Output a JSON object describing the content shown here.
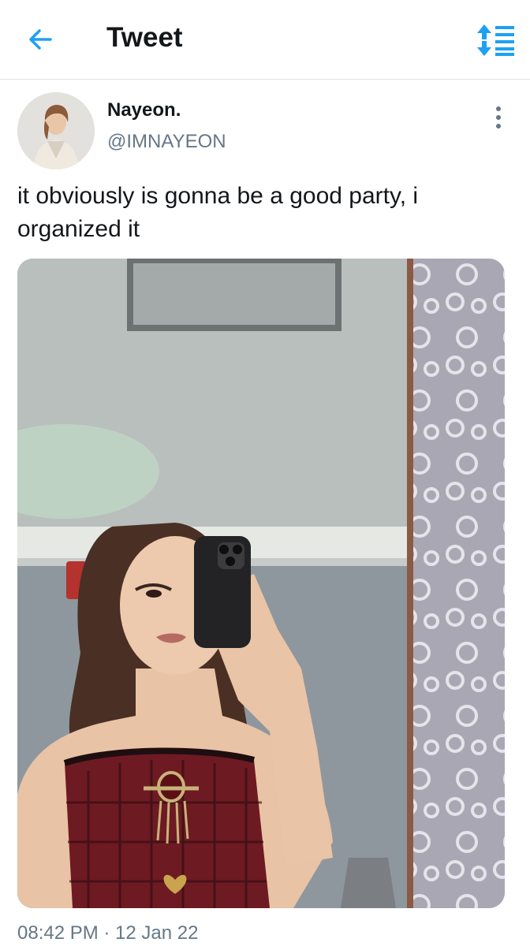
{
  "header": {
    "title": "Tweet",
    "back_icon": "arrow-left-icon",
    "sort_icon": "sort-arrows-icon",
    "accent_color": "#1da1f2"
  },
  "tweet": {
    "author_name": "Nayeon.",
    "author_handle": "@IMNAYEON",
    "more_icon": "more-vertical-icon",
    "text": "it obviously is gonna be a good party, i organized it",
    "timestamp": "08:42 PM · 12 Jan 22"
  },
  "colors": {
    "text_primary": "#14171a",
    "text_secondary": "#657786",
    "divider": "#dfe3e6"
  }
}
